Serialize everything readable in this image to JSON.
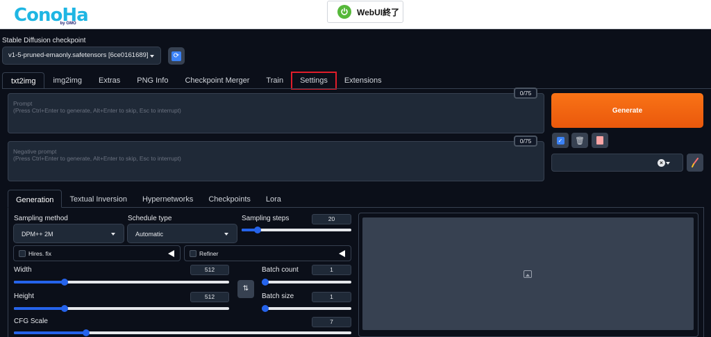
{
  "header": {
    "logo_text": "ConoHa",
    "logo_sub": "by GMO",
    "stop_button_label": "WebUI終了"
  },
  "checkpoint": {
    "label": "Stable Diffusion checkpoint",
    "value": "v1-5-pruned-emaonly.safetensors [6ce0161689]"
  },
  "tabs": [
    "txt2img",
    "img2img",
    "Extras",
    "PNG Info",
    "Checkpoint Merger",
    "Train",
    "Settings",
    "Extensions"
  ],
  "prompt": {
    "title": "Prompt",
    "hint": "(Press Ctrl+Enter to generate, Alt+Enter to skip, Esc to interrupt)",
    "counter": "0/75"
  },
  "negative_prompt": {
    "title": "Negative prompt",
    "hint": "(Press Ctrl+Enter to generate, Alt+Enter to skip, Esc to interrupt)",
    "counter": "0/75"
  },
  "generate_label": "Generate",
  "subtabs": [
    "Generation",
    "Textual Inversion",
    "Hypernetworks",
    "Checkpoints",
    "Lora"
  ],
  "generation": {
    "sampling_method_label": "Sampling method",
    "sampling_method_value": "DPM++ 2M",
    "schedule_type_label": "Schedule type",
    "schedule_type_value": "Automatic",
    "sampling_steps_label": "Sampling steps",
    "sampling_steps_value": "20",
    "hires_fix_label": "Hires. fix",
    "refiner_label": "Refiner",
    "width_label": "Width",
    "width_value": "512",
    "height_label": "Height",
    "height_value": "512",
    "batch_count_label": "Batch count",
    "batch_count_value": "1",
    "batch_size_label": "Batch size",
    "batch_size_value": "1",
    "cfg_scale_label": "CFG Scale",
    "cfg_scale_value": "7"
  },
  "colors": {
    "accent": "#2563eb",
    "generate": "#f97316",
    "highlight": "#e11d2a"
  }
}
